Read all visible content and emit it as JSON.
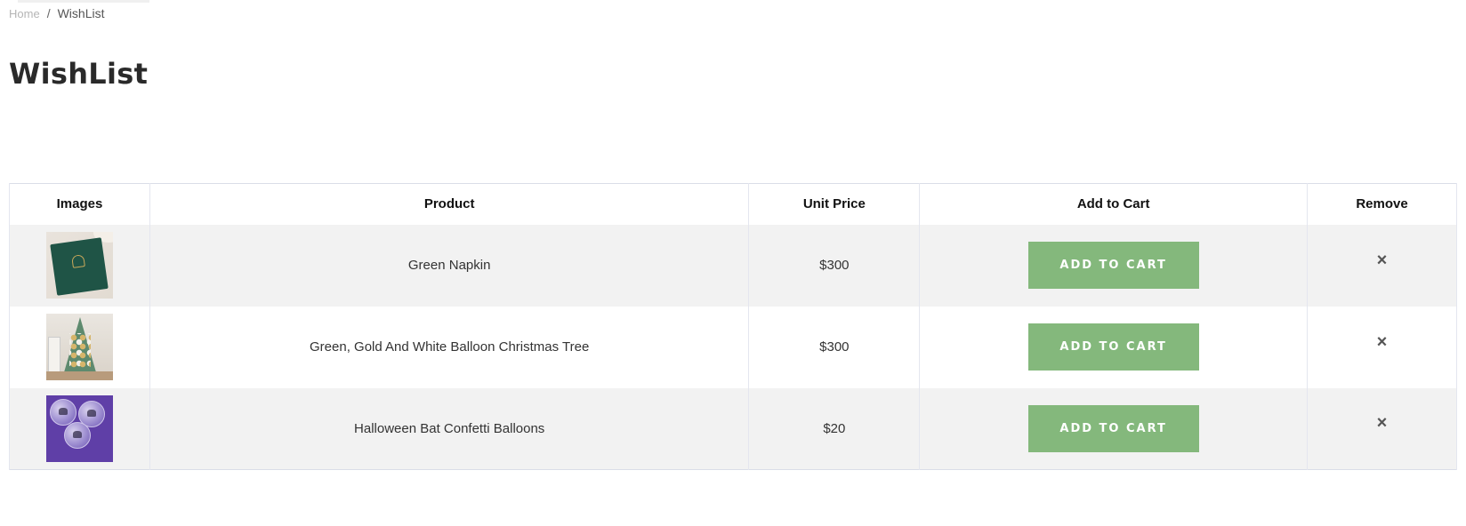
{
  "breadcrumb": {
    "home": "Home",
    "separator": "/",
    "current": "WishList"
  },
  "page_title": "WishList",
  "table": {
    "headers": {
      "images": "Images",
      "product": "Product",
      "unit_price": "Unit Price",
      "add_to_cart": "Add to Cart",
      "remove": "Remove"
    },
    "rows": [
      {
        "image_icon": "green-napkin-image",
        "product": "Green Napkin",
        "price": "$300",
        "button_label": "ADD TO CART",
        "remove_icon": "×"
      },
      {
        "image_icon": "balloon-christmas-tree-image",
        "product": "Green, Gold And White Balloon Christmas Tree",
        "price": "$300",
        "button_label": "ADD TO CART",
        "remove_icon": "×"
      },
      {
        "image_icon": "halloween-bat-balloons-image",
        "product": "Halloween Bat Confetti Balloons",
        "price": "$20",
        "button_label": "ADD TO CART",
        "remove_icon": "×"
      }
    ]
  },
  "colors": {
    "button_bg": "#84b87c",
    "row_alt_bg": "#f2f2f2",
    "table_border": "#dadde8"
  }
}
